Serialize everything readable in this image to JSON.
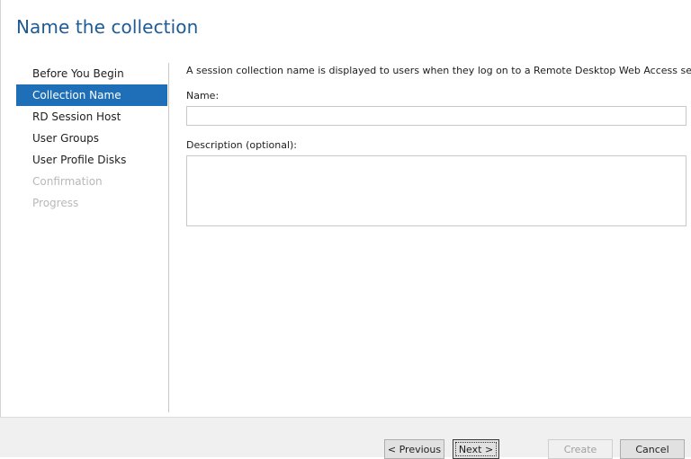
{
  "page": {
    "title": "Name the collection"
  },
  "nav": {
    "items": [
      {
        "label": "Before You Begin",
        "state": "normal"
      },
      {
        "label": "Collection Name",
        "state": "active"
      },
      {
        "label": "RD Session Host",
        "state": "normal"
      },
      {
        "label": "User Groups",
        "state": "normal"
      },
      {
        "label": "User Profile Disks",
        "state": "normal"
      },
      {
        "label": "Confirmation",
        "state": "disabled"
      },
      {
        "label": "Progress",
        "state": "disabled"
      }
    ]
  },
  "content": {
    "intro": "A session collection name is displayed to users when they log on to a Remote Desktop Web Access server.",
    "name_label": "Name:",
    "name_value": "",
    "description_label": "Description (optional):",
    "description_value": ""
  },
  "footer": {
    "previous_label": "< Previous",
    "next_label": "Next >",
    "create_label": "Create",
    "cancel_label": "Cancel"
  },
  "colors": {
    "title": "#1e5b95",
    "nav_active_bg": "#1f6fb8",
    "disabled_text": "#b8b8b8"
  }
}
